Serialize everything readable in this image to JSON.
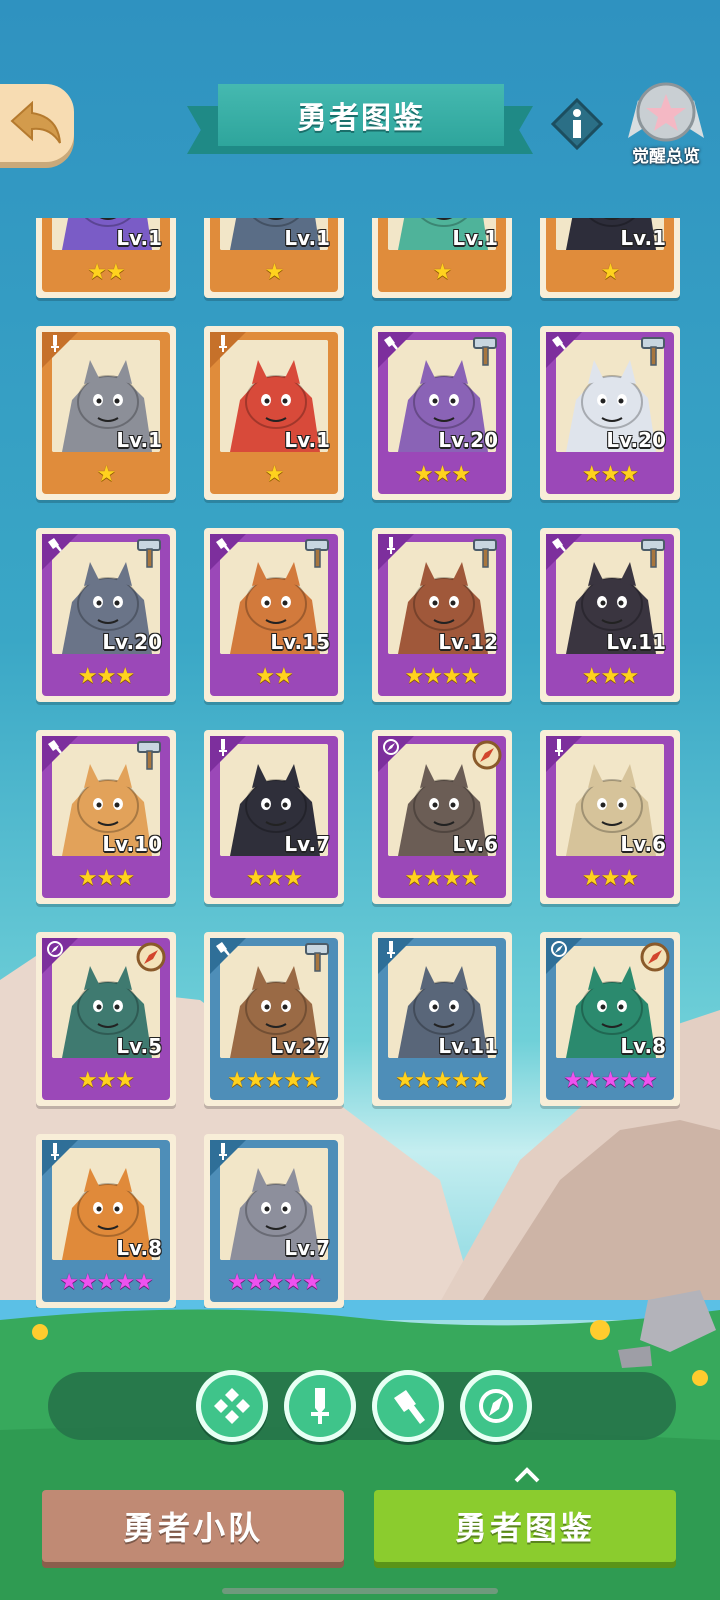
{
  "header": {
    "title": "勇者图鉴",
    "awaken_label": "觉醒总览"
  },
  "heroes": [
    {
      "level": "Lv.1",
      "stars": 2,
      "star_color": "gold",
      "rarity": "orange",
      "class": "sword",
      "weapon": "none",
      "portrait": "purple-creature"
    },
    {
      "level": "Lv.1",
      "stars": 1,
      "star_color": "gold",
      "rarity": "orange",
      "class": "sword",
      "weapon": "none",
      "portrait": "armored-knight"
    },
    {
      "level": "Lv.1",
      "stars": 1,
      "star_color": "gold",
      "rarity": "orange",
      "class": "sword",
      "weapon": "none",
      "portrait": "green-creature"
    },
    {
      "level": "Lv.1",
      "stars": 1,
      "star_color": "gold",
      "rarity": "orange",
      "class": "sword",
      "weapon": "none",
      "portrait": "dark-creature"
    },
    {
      "level": "Lv.1",
      "stars": 1,
      "star_color": "gold",
      "rarity": "orange",
      "class": "sword",
      "weapon": "none",
      "portrait": "gray-wolf-with-bird"
    },
    {
      "level": "Lv.1",
      "stars": 1,
      "star_color": "gold",
      "rarity": "orange",
      "class": "sword",
      "weapon": "none",
      "portrait": "woodpecker"
    },
    {
      "level": "Lv.20",
      "stars": 3,
      "star_color": "gold",
      "rarity": "purple",
      "class": "hammer",
      "weapon": "hammer",
      "portrait": "purple-rhino"
    },
    {
      "level": "Lv.20",
      "stars": 3,
      "star_color": "gold",
      "rarity": "purple",
      "class": "hammer",
      "weapon": "hammer",
      "portrait": "white-wolf"
    },
    {
      "level": "Lv.20",
      "stars": 3,
      "star_color": "gold",
      "rarity": "purple",
      "class": "hammer",
      "weapon": "hammer",
      "portrait": "boar-warrior"
    },
    {
      "level": "Lv.15",
      "stars": 2,
      "star_color": "gold",
      "rarity": "purple",
      "class": "hammer",
      "weapon": "hammer",
      "portrait": "eagle"
    },
    {
      "level": "Lv.12",
      "stars": 4,
      "star_color": "gold",
      "rarity": "purple",
      "class": "sword",
      "weapon": "hammer",
      "portrait": "brown-lizard"
    },
    {
      "level": "Lv.11",
      "stars": 3,
      "star_color": "gold",
      "rarity": "purple",
      "class": "hammer",
      "weapon": "hammer",
      "portrait": "black-cat"
    },
    {
      "level": "Lv.10",
      "stars": 3,
      "star_color": "gold",
      "rarity": "purple",
      "class": "hammer",
      "weapon": "hammer",
      "portrait": "pangolin"
    },
    {
      "level": "Lv.7",
      "stars": 3,
      "star_color": "gold",
      "rarity": "purple",
      "class": "sword",
      "weapon": "none",
      "portrait": "sheep-nun"
    },
    {
      "level": "Lv.6",
      "stars": 4,
      "star_color": "gold",
      "rarity": "purple",
      "class": "compass",
      "weapon": "compass",
      "portrait": "ninja-deer"
    },
    {
      "level": "Lv.6",
      "stars": 3,
      "star_color": "gold",
      "rarity": "purple",
      "class": "sword",
      "weapon": "none",
      "portrait": "old-deer"
    },
    {
      "level": "Lv.5",
      "stars": 3,
      "star_color": "gold",
      "rarity": "purple",
      "class": "compass",
      "weapon": "compass",
      "portrait": "goose-duo"
    },
    {
      "level": "Lv.27",
      "stars": 5,
      "star_color": "gold",
      "rarity": "blue",
      "class": "hammer",
      "weapon": "hammer",
      "portrait": "hooded-mouse"
    },
    {
      "level": "Lv.11",
      "stars": 5,
      "star_color": "gold",
      "rarity": "blue",
      "class": "sword",
      "weapon": "none",
      "portrait": "gray-rat"
    },
    {
      "level": "Lv.8",
      "stars": 5,
      "star_color": "pink",
      "rarity": "blue",
      "class": "compass",
      "weapon": "compass",
      "portrait": "frog-hat"
    },
    {
      "level": "Lv.8",
      "stars": 5,
      "star_color": "pink",
      "rarity": "blue",
      "class": "sword",
      "weapon": "none",
      "portrait": "shiba-police"
    },
    {
      "level": "Lv.7",
      "stars": 5,
      "star_color": "pink",
      "rarity": "blue",
      "class": "sword",
      "weapon": "none",
      "portrait": "gray-cat-girl"
    }
  ],
  "filters": [
    {
      "icon": "all-icon"
    },
    {
      "icon": "sword-icon"
    },
    {
      "icon": "hammer-icon"
    },
    {
      "icon": "compass-icon"
    }
  ],
  "bottom_nav": {
    "team_label": "勇者小队",
    "dex_label": "勇者图鉴"
  }
}
